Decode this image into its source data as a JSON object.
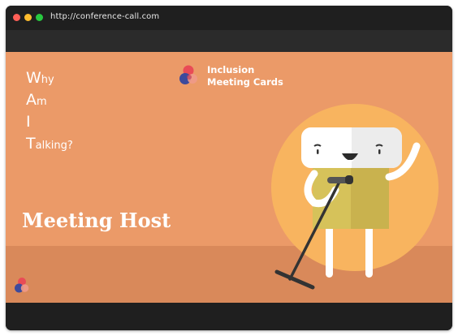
{
  "browser": {
    "url": "http://conference-call.com"
  },
  "slide": {
    "acronym": [
      {
        "cap": "W",
        "rest": "hy"
      },
      {
        "cap": "A",
        "rest": "m"
      },
      {
        "cap": "I",
        "rest": ""
      },
      {
        "cap": "T",
        "rest": "alking?"
      }
    ],
    "brand": {
      "line1": "Inclusion",
      "line2": "Meeting Cards"
    },
    "title": "Meeting Host"
  },
  "colors": {
    "slide_background": "#eb9a68",
    "floor": "#d9895a",
    "sun": "#f8b45f",
    "character_body": "#d6c25a",
    "logo_red": "#e94b56",
    "logo_blue": "#3d4a9c",
    "logo_pink": "#f09a8a"
  },
  "icons": {
    "brand_logo": "inclusion-logo-icon",
    "mini_logo": "inclusion-logo-icon",
    "character": "mascot-with-microphone-icon"
  }
}
